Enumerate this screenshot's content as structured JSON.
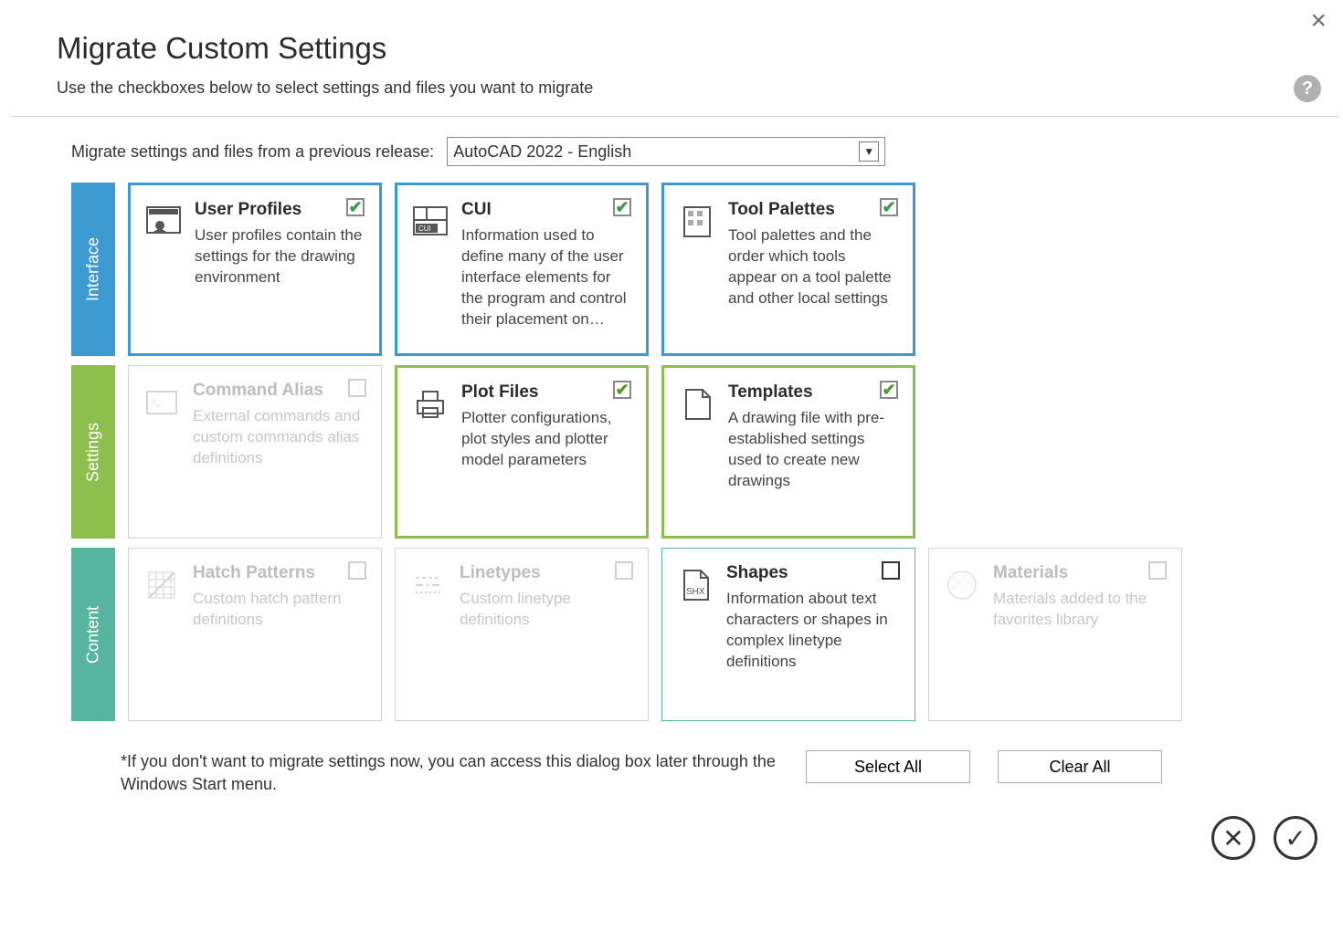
{
  "title": "Migrate Custom Settings",
  "subtitle": "Use the checkboxes below to select settings and files you want to migrate",
  "help_tooltip": "?",
  "source": {
    "label": "Migrate settings and files from a previous release:",
    "value": "AutoCAD 2022 - English"
  },
  "categories": {
    "interface": {
      "label": "Interface",
      "tiles": [
        {
          "title": "User Profiles",
          "desc": "User profiles contain the settings for the drawing environment",
          "checked": true,
          "enabled": true
        },
        {
          "title": "CUI",
          "desc": "Information used to define many of the user interface elements for the program and control their placement on…",
          "checked": true,
          "enabled": true
        },
        {
          "title": "Tool Palettes",
          "desc": "Tool palettes and the order which tools appear on a tool palette and other local settings",
          "checked": true,
          "enabled": true
        }
      ]
    },
    "settings": {
      "label": "Settings",
      "tiles": [
        {
          "title": "Command Alias",
          "desc": "External commands and custom commands alias definitions",
          "checked": false,
          "enabled": false
        },
        {
          "title": "Plot Files",
          "desc": "Plotter configurations, plot styles and plotter model parameters",
          "checked": true,
          "enabled": true
        },
        {
          "title": "Templates",
          "desc": "A drawing file with pre-established settings used to create new drawings",
          "checked": true,
          "enabled": true
        }
      ]
    },
    "content": {
      "label": "Content",
      "tiles": [
        {
          "title": "Hatch Patterns",
          "desc": "Custom hatch pattern definitions",
          "checked": false,
          "enabled": false
        },
        {
          "title": "Linetypes",
          "desc": "Custom linetype definitions",
          "checked": false,
          "enabled": false
        },
        {
          "title": "Shapes",
          "desc": "Information about text characters or shapes in complex linetype definitions",
          "checked": false,
          "enabled": true
        },
        {
          "title": "Materials",
          "desc": "Materials added to the favorites library",
          "checked": false,
          "enabled": false
        }
      ]
    }
  },
  "footnote": "*If you don't want to migrate settings now, you can access this dialog box later through the Windows Start menu.",
  "buttons": {
    "select_all": "Select All",
    "clear_all": "Clear All"
  }
}
